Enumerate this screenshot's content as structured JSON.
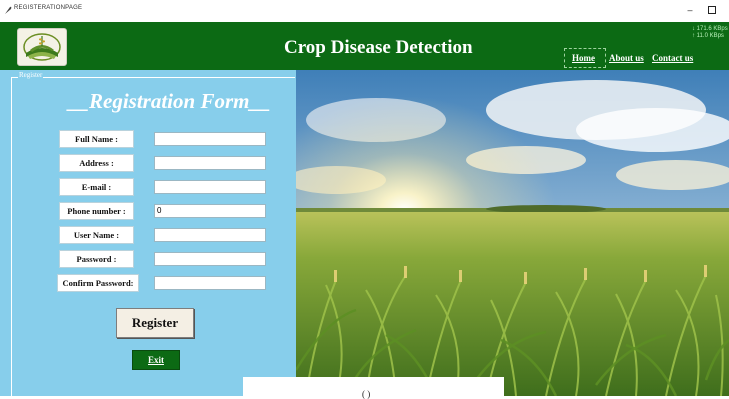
{
  "window": {
    "title": "REGISTERATIONPAGE",
    "minimize_glyph": "–"
  },
  "header": {
    "app_title": "Crop Disease Detection",
    "nav": {
      "home": "Home",
      "about": "About us",
      "contact": "Contact us"
    },
    "network": {
      "down": "↓ 171.6 KBps",
      "up": "↑ 11.0 KBps"
    },
    "logo_icon": "farm-field-logo-icon"
  },
  "form": {
    "frame_label": "Register",
    "title": "__Registration Form__",
    "fields": [
      {
        "label": "Full Name :",
        "value": ""
      },
      {
        "label": "Address :",
        "value": ""
      },
      {
        "label": "E-mail :",
        "value": ""
      },
      {
        "label": "Phone number :",
        "value": "0"
      },
      {
        "label": "User Name :",
        "value": ""
      },
      {
        "label": "Password :",
        "value": ""
      },
      {
        "label": "Confirm Password:",
        "value": ""
      }
    ],
    "register_label": "Register",
    "exit_label": "Exit"
  },
  "overlay": {
    "caption": "( )"
  },
  "colors": {
    "header_green": "#0c6a14",
    "panel_blue": "#87ceeb"
  }
}
